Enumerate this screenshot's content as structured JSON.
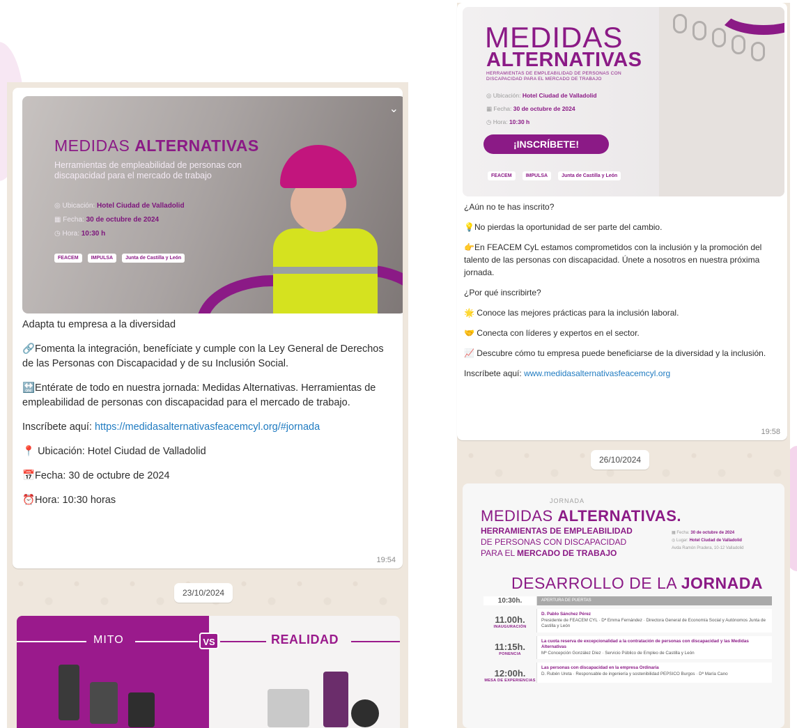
{
  "left_chat": {
    "poster": {
      "title_regular": "MEDIDAS",
      "title_bold": "ALTERNATIVAS",
      "subtitle": "Herramientas de empleabilidad de personas con discapacidad para el mercado de trabajo",
      "location_label": "Ubicación:",
      "location_value": "Hotel Ciudad de Valladolid",
      "date_label": "Fecha:",
      "date_value": "30 de octubre de 2024",
      "time_label": "Hora:",
      "time_value": "10:30 h",
      "logo_1": "FEACEM",
      "logo_2": "IMPULSA",
      "logo_3": "Junta de Castilla y León"
    },
    "message": {
      "line_1": "Adapta tu empresa a la diversidad",
      "line_2": "🔗Fomenta la integración, benefíciate y cumple con la Ley General de Derechos de las Personas con Discapacidad y de su Inclusión Social.",
      "line_3": "🔛Entérate de todo en nuestra jornada: Medidas Alternativas. Herramientas de empleabilidad de personas con discapacidad para el mercado de trabajo.",
      "line_4_prefix": "Inscríbete aquí: ",
      "line_4_link": "https://medidasalternativasfeacemcyl.org/#jornada",
      "line_5": "📍 Ubicación: Hotel Ciudad de Valladolid",
      "line_6": "📅Fecha: 30 de octubre de 2024",
      "line_7": "⏰Hora: 10:30 horas",
      "time": "19:54"
    },
    "date_separator": "23/10/2024",
    "mito_poster": {
      "left_label": "MITO",
      "vs": "VS",
      "right_label": "REALIDAD"
    }
  },
  "right_chat": {
    "poster": {
      "title_1": "MEDIDAS",
      "title_2": "ALTERNATIVAS",
      "subtitle": "HERRAMIENTAS DE EMPLEABILIDAD DE PERSONAS CON DISCAPACIDAD PARA EL MERCADO DE TRABAJO",
      "location_label": "Ubicación:",
      "location_value": "Hotel Ciudad de Valladolid",
      "date_label": "Fecha:",
      "date_value": "30 de octubre de 2024",
      "time_label": "Hora:",
      "time_value": "10:30 h",
      "cta": "¡INSCRÍBETE!",
      "logo_1": "FEACEM",
      "logo_2": "IMPULSA",
      "logo_3": "Junta de Castilla y León"
    },
    "message": {
      "line_1": "¿Aún no te has inscrito?",
      "line_2": "💡No pierdas la oportunidad de ser parte del cambio.",
      "line_3": "👉En FEACEM CyL estamos comprometidos con la inclusión y la promoción del talento de las personas con discapacidad. Únete a nosotros en nuestra próxima jornada.",
      "line_4": "¿Por qué inscribirte?",
      "line_5": "🌟 Conoce las mejores prácticas para la inclusión laboral.",
      "line_6": "🤝 Conecta con líderes y expertos en el sector.",
      "line_7": "📈 Descubre cómo tu empresa puede beneficiarse de la diversidad y la inclusión.",
      "line_8_prefix": "Inscríbete aquí: ",
      "line_8_link": "www.medidasalternativasfeacemcyl.org",
      "time": "19:58"
    },
    "date_separator": "26/10/2024",
    "jornada_poster": {
      "kicker": "JORNADA",
      "title_regular": "MEDIDAS",
      "title_bold": "ALTERNATIVAS.",
      "sub_1": "HERRAMIENTAS DE EMPLEABILIDAD",
      "sub_2": "DE PERSONAS CON DISCAPACIDAD",
      "sub_3_light": "PARA EL ",
      "sub_3_bold": "MERCADO DE TRABAJO",
      "side_date_label": "Fecha:",
      "side_date_value": "30 de octubre de 2024",
      "side_place_label": "Lugar:",
      "side_place_value": "Hotel Ciudad de Valladolid",
      "side_address": "Avda Ramón Pradera, 10-12 Valladolid",
      "heading_regular": "DESARROLLO DE LA",
      "heading_bold": "JORNADA",
      "agenda": [
        {
          "time": "10:30h.",
          "tag": "",
          "text_bold": "APERTURA DE PUERTAS",
          "text": ""
        },
        {
          "time": "11.00h.",
          "tag": "INAUGURACIÓN",
          "text_bold": "D. Pablo Sánchez Pérez",
          "text": "Presidente de FEACEM CYL · Dª Emma Fernández · Directora General de Economía Social y Autónomos Junta de Castilla y León"
        },
        {
          "time": "11:15h.",
          "tag": "PONENCIA",
          "text_bold": "La cuota reserva de excepcionalidad a la contratación de personas con discapacidad y las Medidas Alternativas",
          "text": "Mª Concepción González Díez · Servicio Público de Empleo de Castilla y León"
        },
        {
          "time": "12:00h.",
          "tag": "MESA DE EXPERIENCIAS",
          "text_bold": "Las personas con discapacidad en la empresa Ordinaria",
          "text": "D. Rubén Ureta · Responsable de ingeniería y sostenibilidad PEPSICO Burgos · Dª María Cano"
        }
      ]
    }
  }
}
